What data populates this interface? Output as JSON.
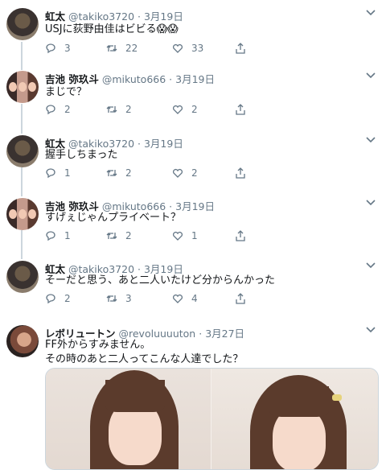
{
  "tweets": [
    {
      "name": "虹太",
      "handle": "@takiko3720",
      "date": "3月19日",
      "text": "USJに荻野由佳はビビる😱😱",
      "replies": "3",
      "retweets": "22",
      "likes": "33"
    },
    {
      "name": "吉池 弥玖斗",
      "handle": "@mikuto666",
      "date": "3月19日",
      "text": "まじで？",
      "replies": "2",
      "retweets": "2",
      "likes": "2"
    },
    {
      "name": "虹太",
      "handle": "@takiko3720",
      "date": "3月19日",
      "text": "握手しちまった",
      "replies": "1",
      "retweets": "2",
      "likes": "2"
    },
    {
      "name": "吉池 弥玖斗",
      "handle": "@mikuto666",
      "date": "3月19日",
      "text": "すげぇじゃんプライベート？",
      "replies": "1",
      "retweets": "2",
      "likes": "1"
    },
    {
      "name": "虹太",
      "handle": "@takiko3720",
      "date": "3月19日",
      "text": "そーだと思う、あと二人いたけど分からんかった",
      "replies": "2",
      "retweets": "3",
      "likes": "4"
    },
    {
      "name": "レボリュートン",
      "handle": "@revoluuuuton",
      "date": "3月27日",
      "text_line1": "FF外からすみません。",
      "text_line2": "その時のあと二人ってこんな人達でした？"
    }
  ],
  "icons": {
    "reply": "reply-icon",
    "retweet": "retweet-icon",
    "like": "heart-icon",
    "share": "share-icon",
    "menu": "chevron-down-icon"
  },
  "colors": {
    "text": "#14171a",
    "muted": "#657786",
    "line": "#ccd6dd"
  },
  "separator": "·"
}
